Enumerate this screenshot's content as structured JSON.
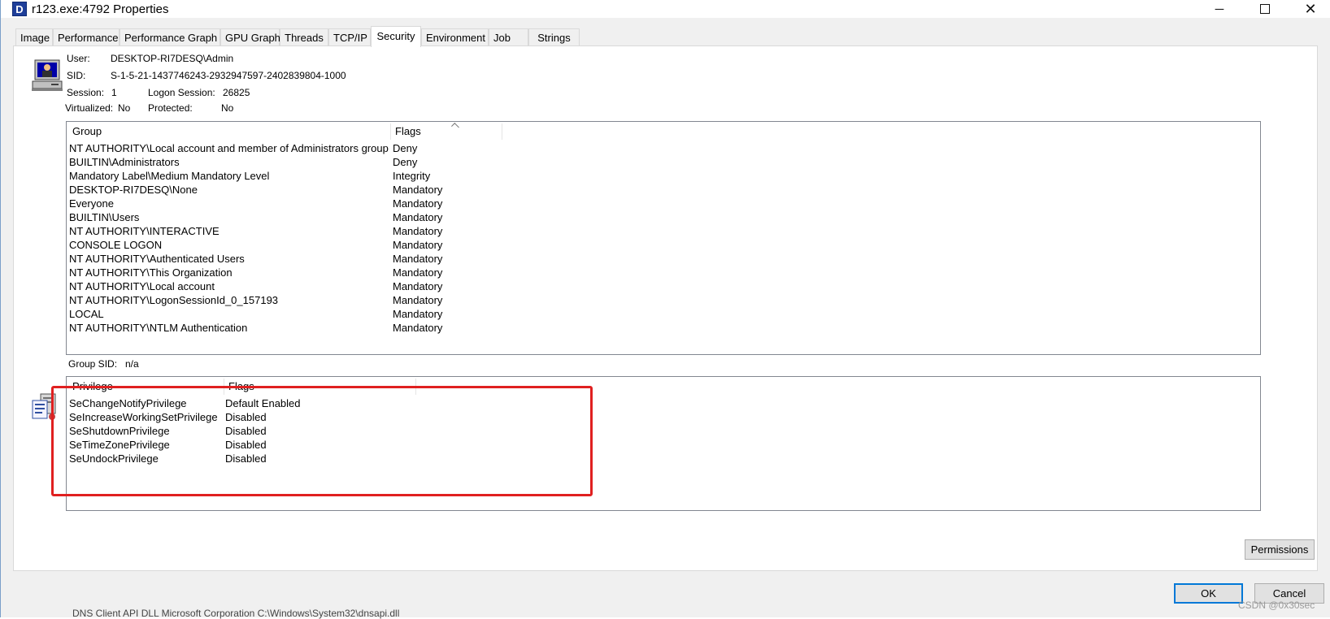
{
  "window": {
    "title": "r123.exe:4792 Properties",
    "app_icon_letter": "D",
    "minimize": "─",
    "close": "✕"
  },
  "tabs": [
    {
      "label": "Image"
    },
    {
      "label": "Performance"
    },
    {
      "label": "Performance Graph"
    },
    {
      "label": "GPU Graph"
    },
    {
      "label": "Threads"
    },
    {
      "label": "TCP/IP"
    },
    {
      "label": "Security"
    },
    {
      "label": "Environment"
    },
    {
      "label": "Job"
    },
    {
      "label": "Strings"
    }
  ],
  "active_tab": "Security",
  "user_info": {
    "user_label": "User:",
    "user_value": "DESKTOP-RI7DESQ\\Admin",
    "sid_label": "SID:",
    "sid_value": "S-1-5-21-1437746243-2932947597-2402839804-1000",
    "session_label": "Session:",
    "session_value": "1",
    "logon_session_label": "Logon Session:",
    "logon_session_value": "26825",
    "virtualized_label": "Virtualized:",
    "virtualized_value": "No",
    "protected_label": "Protected:",
    "protected_value": "No"
  },
  "groups": {
    "columns": [
      "Group",
      "Flags"
    ],
    "rows": [
      {
        "group": "NT AUTHORITY\\Local account and member of Administrators group",
        "flags": "Deny"
      },
      {
        "group": "BUILTIN\\Administrators",
        "flags": "Deny"
      },
      {
        "group": "Mandatory Label\\Medium Mandatory Level",
        "flags": "Integrity"
      },
      {
        "group": "DESKTOP-RI7DESQ\\None",
        "flags": "Mandatory"
      },
      {
        "group": "Everyone",
        "flags": "Mandatory"
      },
      {
        "group": "BUILTIN\\Users",
        "flags": "Mandatory"
      },
      {
        "group": "NT AUTHORITY\\INTERACTIVE",
        "flags": "Mandatory"
      },
      {
        "group": "CONSOLE LOGON",
        "flags": "Mandatory"
      },
      {
        "group": "NT AUTHORITY\\Authenticated Users",
        "flags": "Mandatory"
      },
      {
        "group": "NT AUTHORITY\\This Organization",
        "flags": "Mandatory"
      },
      {
        "group": "NT AUTHORITY\\Local account",
        "flags": "Mandatory"
      },
      {
        "group": "NT AUTHORITY\\LogonSessionId_0_157193",
        "flags": "Mandatory"
      },
      {
        "group": "LOCAL",
        "flags": "Mandatory"
      },
      {
        "group": "NT AUTHORITY\\NTLM Authentication",
        "flags": "Mandatory"
      }
    ]
  },
  "group_sid": {
    "label": "Group SID:",
    "value": "n/a"
  },
  "privileges": {
    "columns": [
      "Privilege",
      "Flags"
    ],
    "rows": [
      {
        "privilege": "SeChangeNotifyPrivilege",
        "flags": "Default Enabled"
      },
      {
        "privilege": "SeIncreaseWorkingSetPrivilege",
        "flags": "Disabled"
      },
      {
        "privilege": "SeShutdownPrivilege",
        "flags": "Disabled"
      },
      {
        "privilege": "SeTimeZonePrivilege",
        "flags": "Disabled"
      },
      {
        "privilege": "SeUndockPrivilege",
        "flags": "Disabled"
      }
    ]
  },
  "buttons": {
    "permissions": "Permissions",
    "ok": "OK",
    "cancel": "Cancel"
  },
  "watermark": "CSDN @0x30sec",
  "background_text": "DNS Client API DLL          Microsoft Corporation          C:\\Windows\\System32\\dnsapi.dll",
  "colors": {
    "highlight_box": "#e02020",
    "default_button_border": "#0078d7",
    "app_icon": "#1f3f9a"
  }
}
